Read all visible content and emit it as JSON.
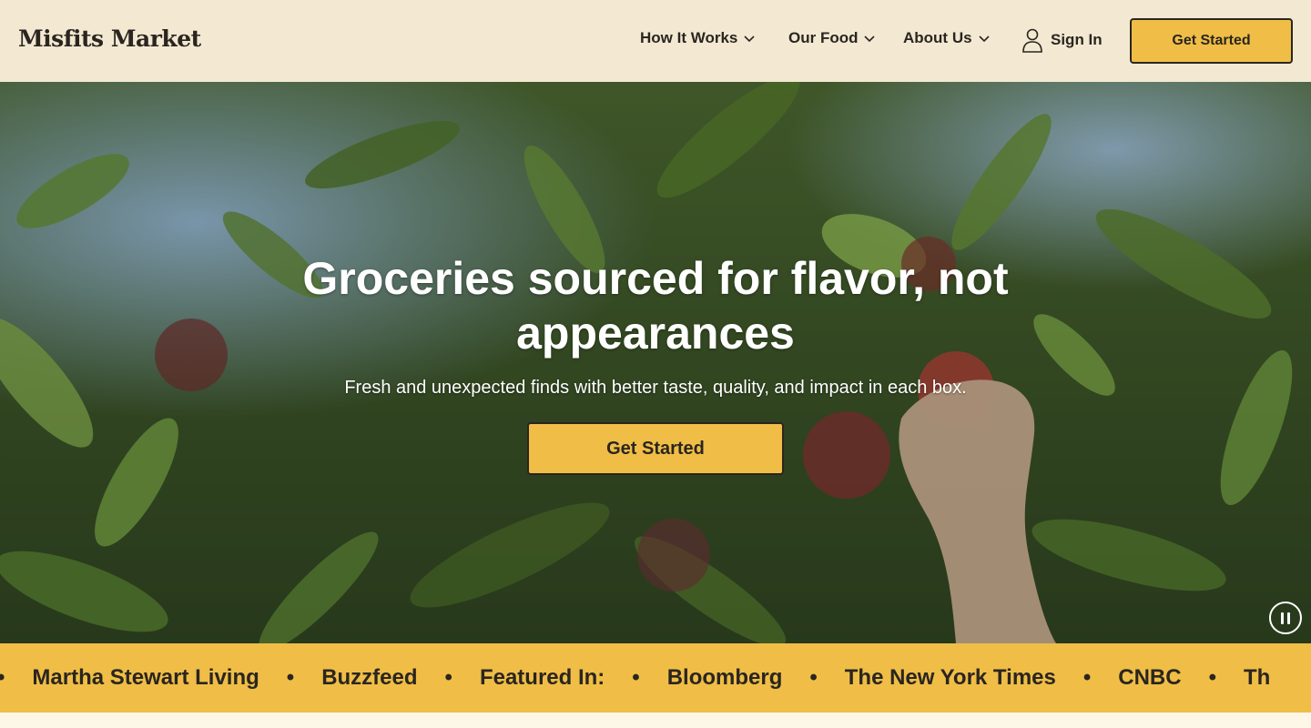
{
  "header": {
    "logo": "Misfits Market",
    "nav": [
      {
        "label": "How It Works"
      },
      {
        "label": "Our Food"
      },
      {
        "label": "About Us"
      }
    ],
    "sign_in": "Sign In",
    "cta": "Get Started"
  },
  "hero": {
    "headline_line1": "Groceries sourced for flavor, not",
    "headline_line2": "appearances",
    "subhead": "Fresh and unexpected finds with better taste, quality, and impact in each box.",
    "cta": "Get Started",
    "media_control": "pause-icon"
  },
  "ticker": {
    "items": [
      "Martha Stewart Living",
      "Buzzfeed",
      "Featured In:",
      "Bloomberg",
      "The New York Times",
      "CNBC",
      "Th"
    ],
    "separator": "•"
  },
  "colors": {
    "header_bg": "#f3e9d2",
    "accent": "#f0be46",
    "text_dark": "#2a2520"
  }
}
